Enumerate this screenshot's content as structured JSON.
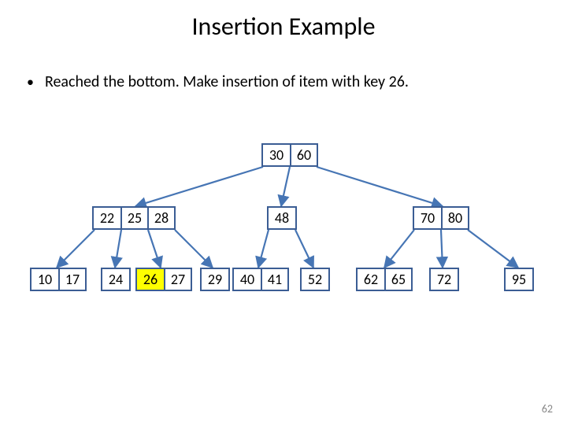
{
  "slide": {
    "title": "Insertion Example",
    "bullet": "Reached the bottom. Make insertion of item with key 26.",
    "page_number": "62"
  },
  "tree": {
    "level0": {
      "n0": [
        "30",
        "60"
      ]
    },
    "level1": {
      "n0": [
        "22",
        "25",
        "28"
      ],
      "n1": [
        "48"
      ],
      "n2": [
        "70",
        "80"
      ]
    },
    "level2": {
      "n0": [
        "10",
        "17"
      ],
      "n1": [
        "24"
      ],
      "n2": [
        "26",
        "27"
      ],
      "n3": [
        "29"
      ],
      "n4": [
        "40",
        "41"
      ],
      "n5": [
        "52"
      ],
      "n6": [
        "62",
        "65"
      ],
      "n7": [
        "72"
      ],
      "n8": [
        "95"
      ]
    },
    "highlighted_cell_path": "level2.n2.0"
  }
}
